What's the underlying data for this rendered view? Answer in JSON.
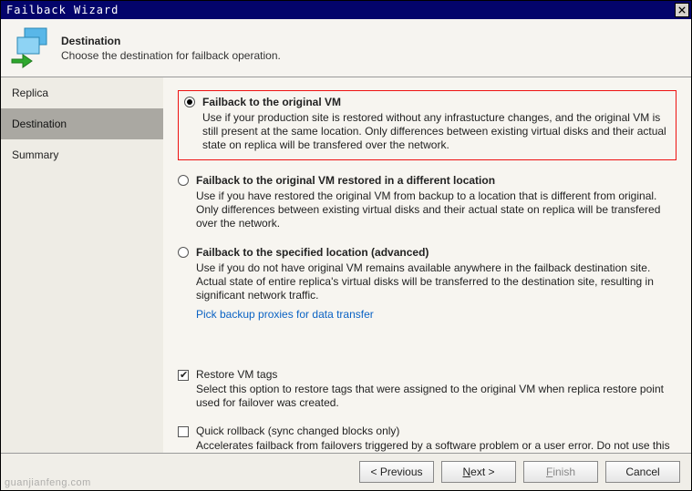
{
  "window": {
    "title": "Failback Wizard"
  },
  "header": {
    "title": "Destination",
    "subtitle": "Choose the destination for failback operation."
  },
  "sidebar": {
    "items": [
      {
        "label": "Replica"
      },
      {
        "label": "Destination"
      },
      {
        "label": "Summary"
      }
    ]
  },
  "options": {
    "opt1": {
      "title": "Failback to the original VM",
      "desc": "Use if your production site is restored without any infrastucture changes, and the original VM is still present at the same location.  Only differences between existing virtual disks and their actual state on replica will be transfered over the network."
    },
    "opt2": {
      "title": "Failback to the original VM restored in a different location",
      "desc": "Use if you have restored the original VM from backup to a location that is different from original. Only differences between existing virtual disks and their actual state on replica will be transfered over the network."
    },
    "opt3": {
      "title": "Failback to the specified location (advanced)",
      "desc": "Use if you do not have original VM remains available anywhere in the failback destination site. Actual state of entire replica's virtual disks will be transferred to the destination site, resulting in significant network traffic."
    },
    "proxy_link": "Pick backup proxies for data transfer",
    "restore_tags": {
      "title": "Restore VM tags",
      "desc": "Select this option to restore tags that were assigned to the original VM when replica restore point used for failover was created."
    },
    "quick_rollback": {
      "title": "Quick rollback (sync changed blocks only)",
      "desc": "Accelerates failback from failovers triggered by a software problem or a user error. Do not use this option if the disaster was caused by a hardware or storage issue, or by a power loss."
    }
  },
  "buttons": {
    "previous": "< Previous",
    "next_prefix": "N",
    "next_suffix": "ext >",
    "finish_prefix": "F",
    "finish_suffix": "inish",
    "cancel": "Cancel"
  },
  "watermark": "guanjianfeng.com"
}
